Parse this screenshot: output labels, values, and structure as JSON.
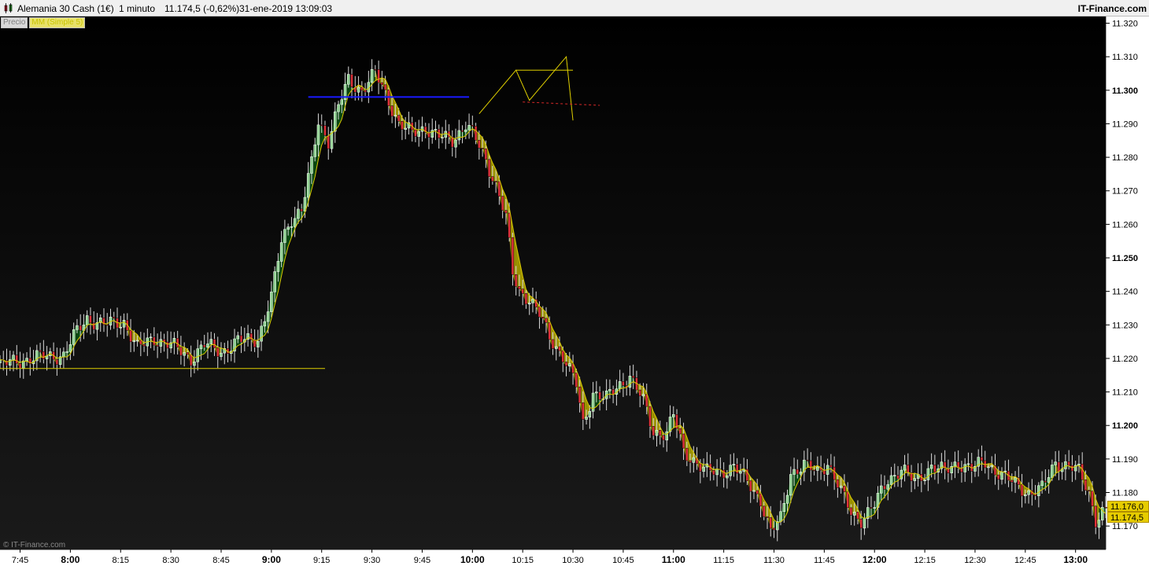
{
  "header": {
    "instrument": "Alemania 30 Cash (1€)",
    "timeframe": "1 minuto",
    "price_change": "11.174,5 (-0,62%)",
    "datetime": "31-ene-2019 13:09:03",
    "brand": "IT-Finance.com"
  },
  "legend": {
    "price_label": "Precio",
    "ma_label": "MM (Simple 5)"
  },
  "watermark": "© IT-Finance.com",
  "price_tags": {
    "ma_value": "11.176,0",
    "last_value": "11.174,5"
  },
  "colors": {
    "up_candle": "#ffffff",
    "up_candle_fill": "#8fd18f",
    "down_candle_fill": "#e0323a",
    "ma_line": "#d8c800",
    "cloud_fill": "#a59b00",
    "cloud_fill_green": "#0b4d12",
    "support_line": "#e0d000",
    "resistance_line": "#1a1aff",
    "dashed_line": "#d62828"
  },
  "chart_data": {
    "type": "candlestick",
    "title": "",
    "xlabel": "",
    "ylabel": "",
    "ylim": [
      11163,
      11322
    ],
    "y_ticks": [
      {
        "value": 11320,
        "label": "11.320",
        "bold": false
      },
      {
        "value": 11310,
        "label": "11.310",
        "bold": false
      },
      {
        "value": 11300,
        "label": "11.300",
        "bold": true
      },
      {
        "value": 11290,
        "label": "11.290",
        "bold": false
      },
      {
        "value": 11280,
        "label": "11.280",
        "bold": false
      },
      {
        "value": 11270,
        "label": "11.270",
        "bold": false
      },
      {
        "value": 11260,
        "label": "11.260",
        "bold": false
      },
      {
        "value": 11250,
        "label": "11.250",
        "bold": true
      },
      {
        "value": 11240,
        "label": "11.240",
        "bold": false
      },
      {
        "value": 11230,
        "label": "11.230",
        "bold": false
      },
      {
        "value": 11220,
        "label": "11.220",
        "bold": false
      },
      {
        "value": 11210,
        "label": "11.210",
        "bold": false
      },
      {
        "value": 11200,
        "label": "11.200",
        "bold": true
      },
      {
        "value": 11190,
        "label": "11.190",
        "bold": false
      },
      {
        "value": 11180,
        "label": "11.180",
        "bold": false
      },
      {
        "value": 11170,
        "label": "11.170",
        "bold": false
      }
    ],
    "x_ticks": [
      {
        "label": "7:45",
        "bold": false
      },
      {
        "label": "8:00",
        "bold": true
      },
      {
        "label": "8:15",
        "bold": false
      },
      {
        "label": "8:30",
        "bold": false
      },
      {
        "label": "8:45",
        "bold": false
      },
      {
        "label": "9:00",
        "bold": true
      },
      {
        "label": "9:15",
        "bold": false
      },
      {
        "label": "9:30",
        "bold": false
      },
      {
        "label": "9:45",
        "bold": false
      },
      {
        "label": "10:00",
        "bold": true
      },
      {
        "label": "10:15",
        "bold": false
      },
      {
        "label": "10:30",
        "bold": false
      },
      {
        "label": "10:45",
        "bold": false
      },
      {
        "label": "11:00",
        "bold": true
      },
      {
        "label": "11:15",
        "bold": false
      },
      {
        "label": "11:30",
        "bold": false
      },
      {
        "label": "11:45",
        "bold": false
      },
      {
        "label": "12:00",
        "bold": true
      },
      {
        "label": "12:15",
        "bold": false
      },
      {
        "label": "12:30",
        "bold": false
      },
      {
        "label": "12:45",
        "bold": false
      },
      {
        "label": "13:00",
        "bold": true
      }
    ],
    "x_start": "7:39",
    "x_end": "13:09",
    "series": [
      {
        "kind": "close_path",
        "points": [
          [
            "7:39",
            11218
          ],
          [
            "7:48",
            11220
          ],
          [
            "7:58",
            11221
          ],
          [
            "8:02",
            11228
          ],
          [
            "8:05",
            11232
          ],
          [
            "8:10",
            11230
          ],
          [
            "8:16",
            11231
          ],
          [
            "8:20",
            11223
          ],
          [
            "8:25",
            11226
          ],
          [
            "8:30",
            11224
          ],
          [
            "8:36",
            11220
          ],
          [
            "8:40",
            11224
          ],
          [
            "8:45",
            11222
          ],
          [
            "8:50",
            11225
          ],
          [
            "8:56",
            11226
          ],
          [
            "9:00",
            11238
          ],
          [
            "9:03",
            11255
          ],
          [
            "9:06",
            11262
          ],
          [
            "9:09",
            11264
          ],
          [
            "9:12",
            11278
          ],
          [
            "9:14",
            11291
          ],
          [
            "9:17",
            11285
          ],
          [
            "9:20",
            11295
          ],
          [
            "9:23",
            11303
          ],
          [
            "9:27",
            11300
          ],
          [
            "9:31",
            11305
          ],
          [
            "9:35",
            11297
          ],
          [
            "9:38",
            11290
          ],
          [
            "9:42",
            11287
          ],
          [
            "9:46",
            11289
          ],
          [
            "9:50",
            11286
          ],
          [
            "9:54",
            11285
          ],
          [
            "9:58",
            11290
          ],
          [
            "10:00",
            11287
          ],
          [
            "10:04",
            11279
          ],
          [
            "10:07",
            11272
          ],
          [
            "10:10",
            11262
          ],
          [
            "10:12",
            11245
          ],
          [
            "10:14",
            11240
          ],
          [
            "10:17",
            11238
          ],
          [
            "10:20",
            11233
          ],
          [
            "10:23",
            11226
          ],
          [
            "10:27",
            11221
          ],
          [
            "10:31",
            11212
          ],
          [
            "10:33",
            11200
          ],
          [
            "10:36",
            11210
          ],
          [
            "10:40",
            11208
          ],
          [
            "10:44",
            11212
          ],
          [
            "10:47",
            11215
          ],
          [
            "10:51",
            11207
          ],
          [
            "10:54",
            11198
          ],
          [
            "10:58",
            11198
          ],
          [
            "11:00",
            11203
          ],
          [
            "11:03",
            11192
          ],
          [
            "11:06",
            11190
          ],
          [
            "11:10",
            11186
          ],
          [
            "11:14",
            11186
          ],
          [
            "11:18",
            11188
          ],
          [
            "11:22",
            11183
          ],
          [
            "11:26",
            11178
          ],
          [
            "11:29",
            11168
          ],
          [
            "11:32",
            11172
          ],
          [
            "11:35",
            11186
          ],
          [
            "11:39",
            11188
          ],
          [
            "11:43",
            11186
          ],
          [
            "11:46",
            11189
          ],
          [
            "11:50",
            11180
          ],
          [
            "11:53",
            11174
          ],
          [
            "11:56",
            11172
          ],
          [
            "12:00",
            11176
          ],
          [
            "12:04",
            11184
          ],
          [
            "12:08",
            11187
          ],
          [
            "12:12",
            11183
          ],
          [
            "12:17",
            11188
          ],
          [
            "12:21",
            11186
          ],
          [
            "12:25",
            11189
          ],
          [
            "12:29",
            11187
          ],
          [
            "12:33",
            11189
          ],
          [
            "12:37",
            11186
          ],
          [
            "12:41",
            11183
          ],
          [
            "12:46",
            11180
          ],
          [
            "12:50",
            11181
          ],
          [
            "12:54",
            11189
          ],
          [
            "12:58",
            11188
          ],
          [
            "13:01",
            11186
          ],
          [
            "13:04",
            11180
          ],
          [
            "13:06",
            11172
          ],
          [
            "13:08",
            11174
          ],
          [
            "13:09",
            11174.5
          ]
        ]
      }
    ],
    "lines": [
      {
        "kind": "horizontal",
        "color": "support",
        "y": 11217,
        "x_from": "7:39",
        "x_to": "9:16"
      },
      {
        "kind": "horizontal",
        "color": "resistance",
        "y": 11298,
        "x_from": "9:11",
        "x_to": "9:59"
      },
      {
        "kind": "polyline",
        "color": "support",
        "points": [
          [
            "10:02",
            11293
          ],
          [
            "10:13",
            11306
          ],
          [
            "10:17",
            11297
          ],
          [
            "10:28",
            11310
          ],
          [
            "10:30",
            11291
          ]
        ]
      },
      {
        "kind": "horizontal",
        "color": "support",
        "y": 11306,
        "x_from": "10:13",
        "x_to": "10:30"
      },
      {
        "kind": "dashed",
        "color": "dashed",
        "points": [
          [
            "10:15",
            11296.5
          ],
          [
            "10:38",
            11295.5
          ]
        ]
      }
    ]
  }
}
